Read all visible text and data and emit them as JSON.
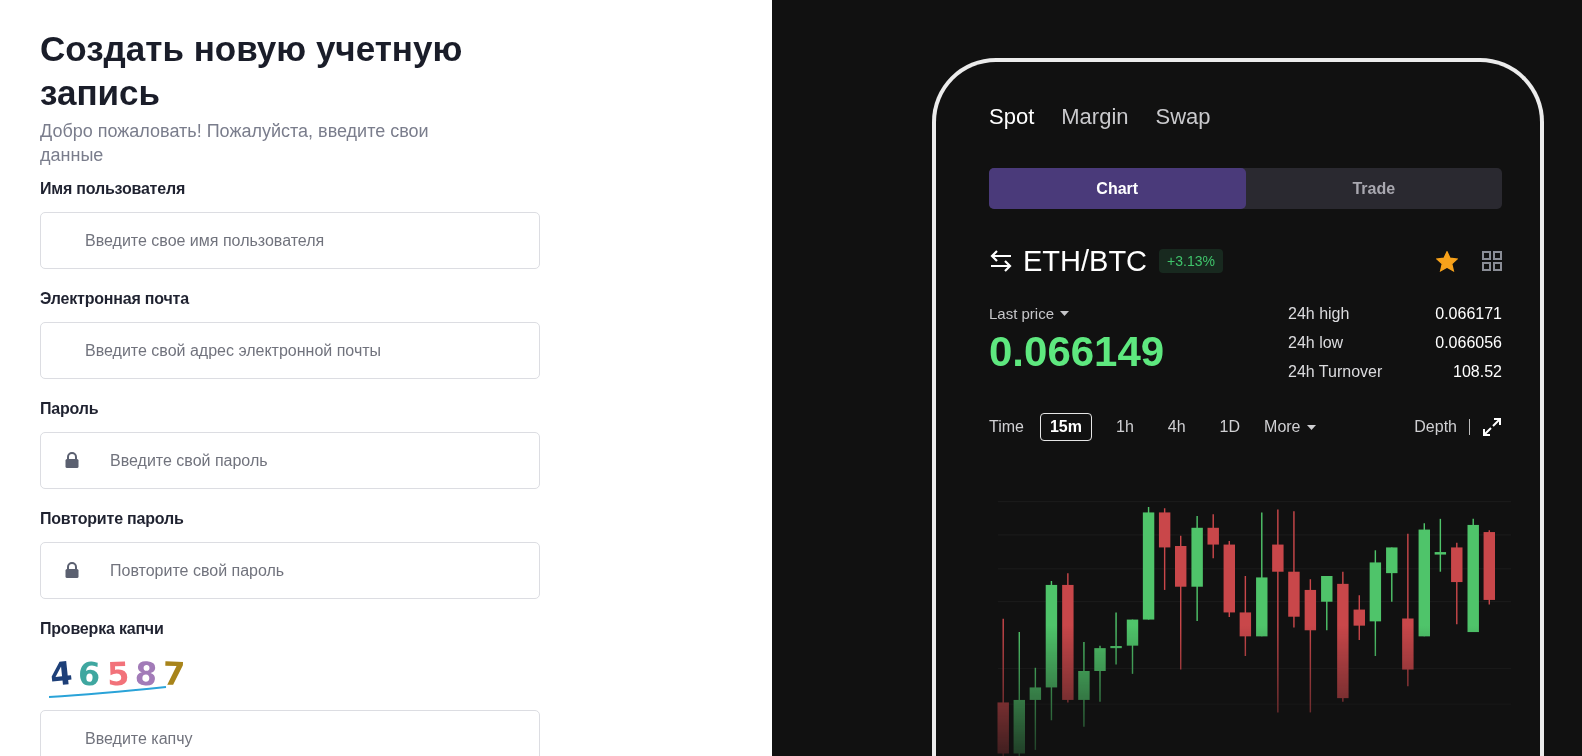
{
  "form": {
    "title": "Создать новую учетную запись",
    "subtitle": "Добро пожаловать! Пожалуйста, введите свои данные",
    "fields": [
      {
        "kind": "text",
        "label": "Имя пользователя",
        "placeholder": "Введите свое имя пользователя"
      },
      {
        "kind": "text",
        "label": "Электронная почта",
        "placeholder": "Введите свой адрес электронной почты"
      },
      {
        "kind": "password",
        "label": "Пароль",
        "placeholder": "Введите свой пароль"
      },
      {
        "kind": "password",
        "label": "Повторите пароль",
        "placeholder": "Повторите свой пароль"
      },
      {
        "kind": "captcha",
        "label": "Проверка капчи",
        "placeholder": "Введите капчу",
        "characters": [
          {
            "char": "4",
            "color": "#1d3f78"
          },
          {
            "char": "6",
            "color": "#3fa7a0"
          },
          {
            "char": "5",
            "color": "#f2727a"
          },
          {
            "char": "8",
            "color": "#a27bb8"
          },
          {
            "char": "7",
            "color": "#a8841a"
          }
        ]
      }
    ]
  },
  "market": {
    "tabs": [
      {
        "label": "Spot",
        "selected": true
      },
      {
        "label": "Margin",
        "selected": false
      },
      {
        "label": "Swap",
        "selected": false
      }
    ],
    "view_toggle": [
      {
        "label": "Chart",
        "selected": true
      },
      {
        "label": "Trade",
        "selected": false
      }
    ],
    "pair": "ETH/BTC",
    "change": "+3.13%",
    "favorite": true,
    "last_price_label": "Last price",
    "last_price": "0.066149",
    "stats": [
      {
        "label": "24h high",
        "value": "0.066171"
      },
      {
        "label": "24h low",
        "value": "0.066056"
      },
      {
        "label": "24h Turnover",
        "value": "108.52"
      }
    ],
    "time_label": "Time",
    "intervals": [
      {
        "label": "15m",
        "selected": true
      },
      {
        "label": "1h",
        "selected": false
      },
      {
        "label": "4h",
        "selected": false
      },
      {
        "label": "1D",
        "selected": false
      }
    ],
    "more": "More",
    "depth": "Depth"
  }
}
